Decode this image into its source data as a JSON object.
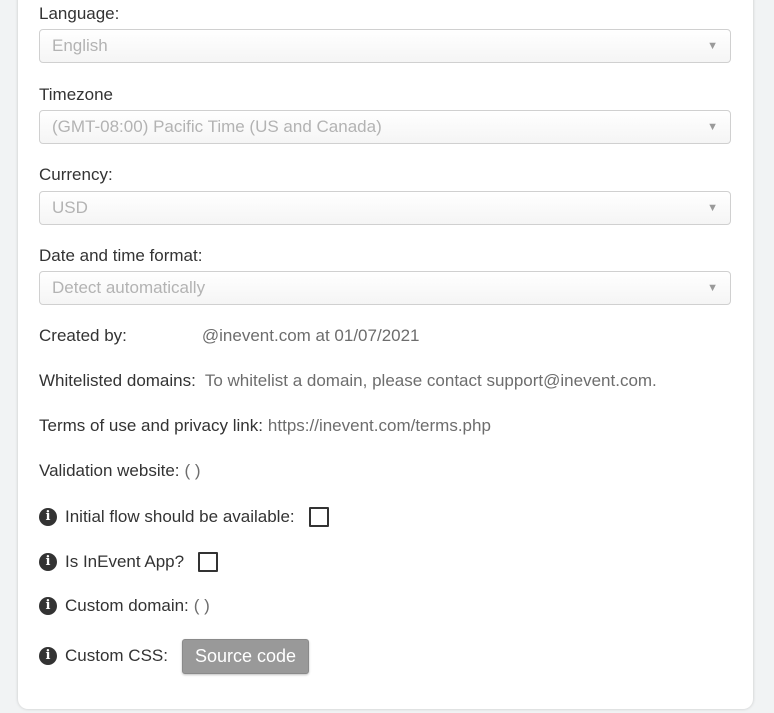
{
  "language": {
    "label": "Language:",
    "value": "English"
  },
  "timezone": {
    "label": "Timezone",
    "value": "(GMT-08:00) Pacific Time (US and Canada)"
  },
  "currency": {
    "label": "Currency:",
    "value": "USD"
  },
  "datetime": {
    "label": "Date and time format:",
    "value": "Detect automatically"
  },
  "dropdown_arrow": "▼",
  "created_by": {
    "label": "Created by:",
    "value": "@inevent.com at 01/07/2021"
  },
  "whitelisted": {
    "label": "Whitelisted domains:",
    "value": "To whitelist a domain, please contact support@inevent.com."
  },
  "terms": {
    "label": "Terms of use and privacy link:",
    "value": "https://inevent.com/terms.php"
  },
  "validation": {
    "label": "Validation website:",
    "value": "( )"
  },
  "initial_flow": {
    "label": "Initial flow should be available:"
  },
  "inevent_app": {
    "label": "Is InEvent App?"
  },
  "custom_domain": {
    "label": "Custom domain:",
    "value": "( )"
  },
  "custom_css": {
    "label": "Custom CSS:",
    "button": "Source code"
  },
  "info_icon_glyph": "i"
}
